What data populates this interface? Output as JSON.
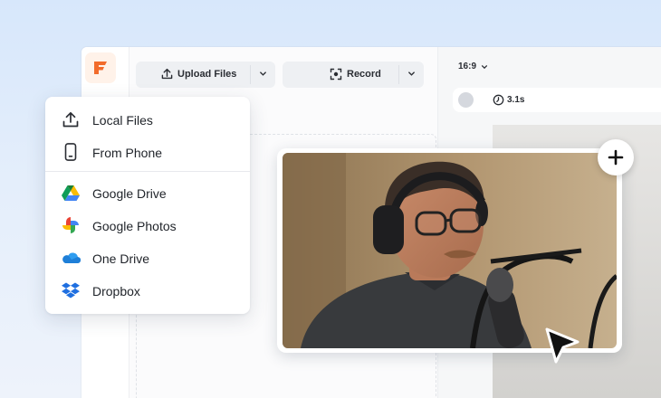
{
  "toolbar": {
    "upload_label": "Upload Files",
    "record_label": "Record"
  },
  "editor": {
    "aspect_ratio": "16:9",
    "clip_duration": "3.1s"
  },
  "source_menu": {
    "items": [
      {
        "label": "Local Files",
        "icon": "upload-icon"
      },
      {
        "label": "From Phone",
        "icon": "phone-icon"
      },
      {
        "label": "Google Drive",
        "icon": "google-drive-icon"
      },
      {
        "label": "Google Photos",
        "icon": "google-photos-icon"
      },
      {
        "label": "One Drive",
        "icon": "onedrive-icon"
      },
      {
        "label": "Dropbox",
        "icon": "dropbox-icon"
      }
    ]
  },
  "colors": {
    "brand": "#f26b2b",
    "brand_tint": "#fff2e9",
    "onedrive": "#1e7fd8",
    "dropbox": "#1f6fe0"
  }
}
